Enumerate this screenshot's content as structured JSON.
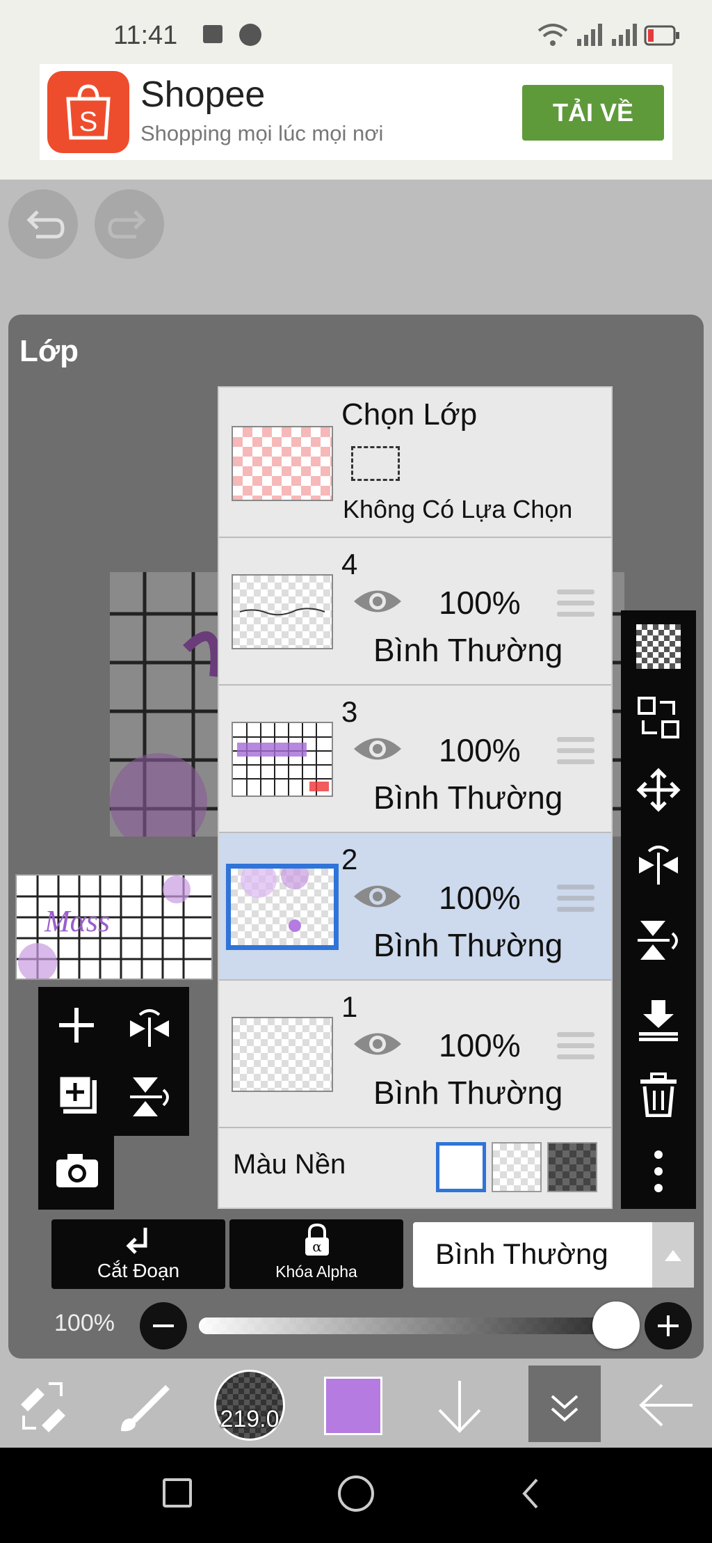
{
  "status": {
    "time": "11:41"
  },
  "ad": {
    "title": "Shopee",
    "subtitle": "Shopping mọi lúc mọi nơi",
    "button": "TẢI VỀ",
    "logo_letter": "S",
    "brand_color": "#ee4d2d"
  },
  "panel": {
    "title": "Lớp"
  },
  "selection": {
    "title": "Chọn Lớp",
    "subtitle": "Không Có Lựa Chọn"
  },
  "layers": [
    {
      "num": "4",
      "opacity": "100%",
      "mode": "Bình Thường"
    },
    {
      "num": "3",
      "opacity": "100%",
      "mode": "Bình Thường"
    },
    {
      "num": "2",
      "opacity": "100%",
      "mode": "Bình Thường",
      "selected": true
    },
    {
      "num": "1",
      "opacity": "100%",
      "mode": "Bình Thường"
    }
  ],
  "background": {
    "label": "Màu Nền"
  },
  "bottom": {
    "clip_label": "Cắt Đoạn",
    "alpha_label": "Khóa Alpha",
    "blend_mode": "Bình Thường",
    "opacity_label": "100%",
    "opacity_value": 1.0
  },
  "toolbar": {
    "brush_size": "219.0",
    "color": "#b57be0"
  },
  "colors": {
    "selected_row": "#cdd9ec",
    "accent_blue": "#2f74d8"
  }
}
